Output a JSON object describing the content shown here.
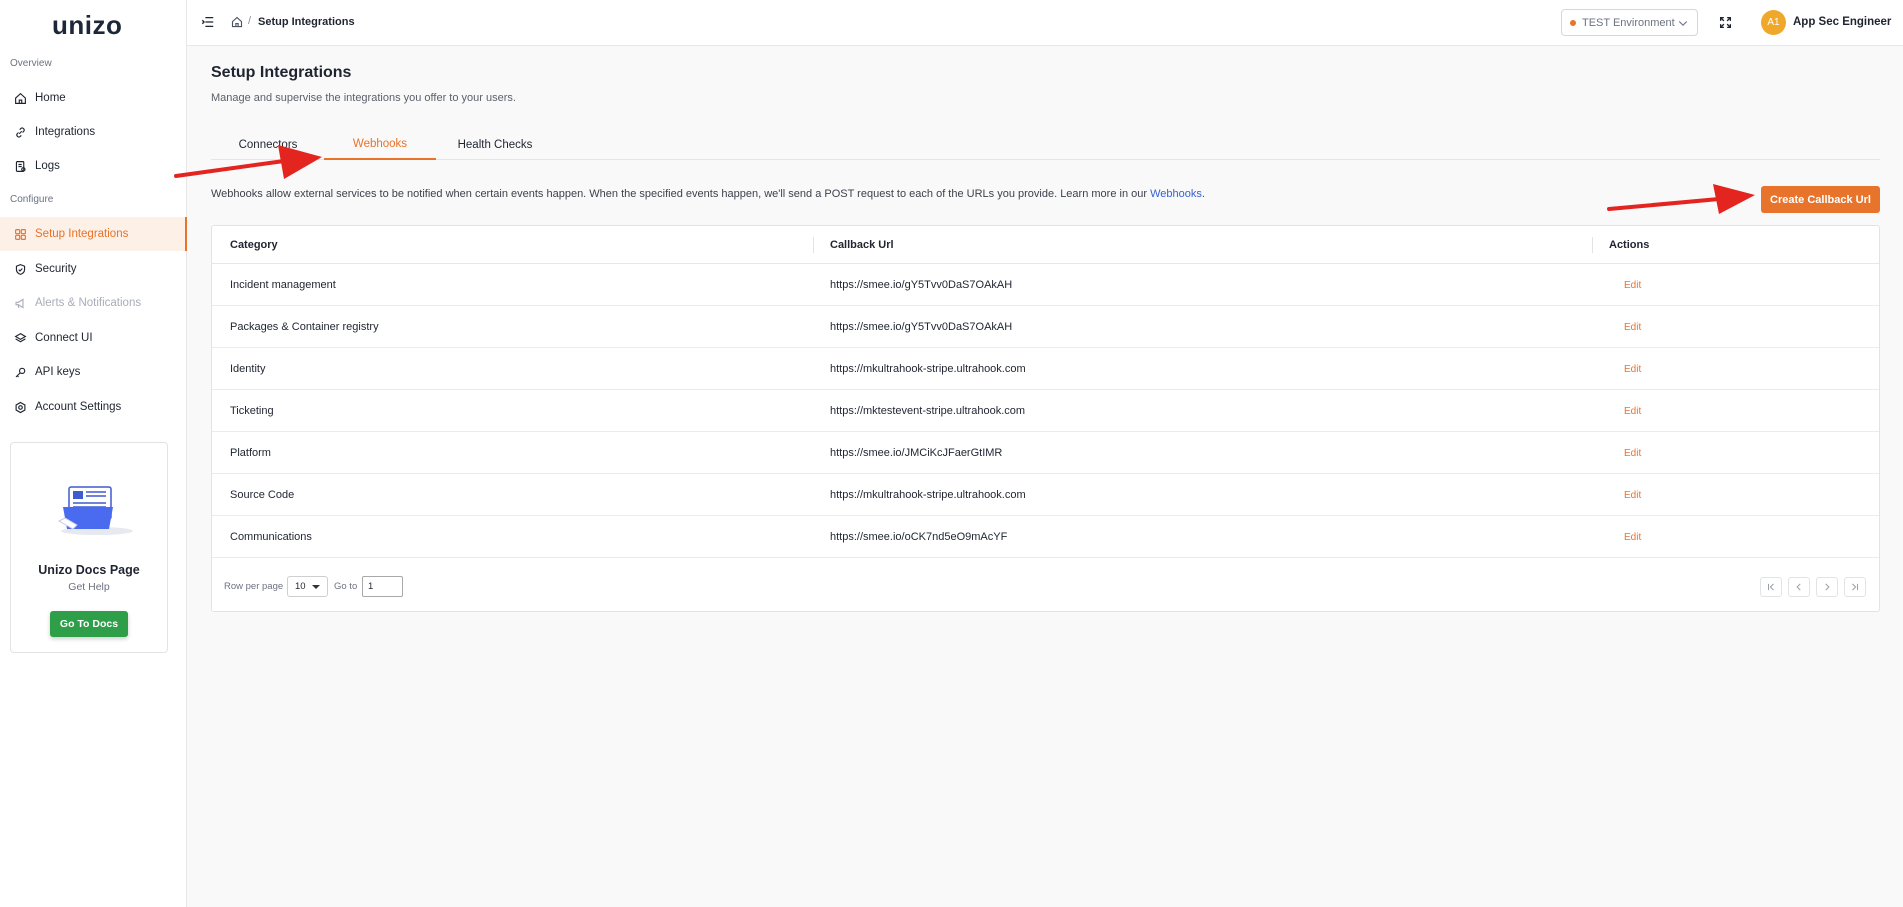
{
  "brand": {
    "logo": "unizo",
    "accent": "#e8732a"
  },
  "sidebar": {
    "sections": [
      {
        "label": "Overview"
      },
      {
        "label": "Configure"
      }
    ],
    "items": [
      {
        "label": "Home",
        "icon": "home-icon"
      },
      {
        "label": "Integrations",
        "icon": "link-icon"
      },
      {
        "label": "Logs",
        "icon": "logs-icon"
      },
      {
        "label": "Setup Integrations",
        "icon": "grid-icon",
        "active": true
      },
      {
        "label": "Security",
        "icon": "shield-icon"
      },
      {
        "label": "Alerts & Notifications",
        "icon": "megaphone-icon",
        "disabled": true
      },
      {
        "label": "Connect UI",
        "icon": "layers-icon"
      },
      {
        "label": "API keys",
        "icon": "key-icon"
      },
      {
        "label": "Account Settings",
        "icon": "gear-icon"
      }
    ],
    "docs_card": {
      "title": "Unizo Docs Page",
      "subtitle": "Get Help",
      "button": "Go To Docs"
    }
  },
  "topbar": {
    "breadcrumb_separator": "/",
    "breadcrumb_current": "Setup Integrations",
    "environment": "TEST Environment",
    "user_initials": "A1",
    "user_name": "App Sec Engineer"
  },
  "main": {
    "title": "Setup Integrations",
    "subtitle": "Manage and supervise the integrations you offer to your users.",
    "tabs": [
      {
        "label": "Connectors"
      },
      {
        "label": "Webhooks",
        "active": true
      },
      {
        "label": "Health Checks"
      }
    ],
    "description": "Webhooks allow external services to be notified when certain events happen. When the specified events happen, we'll send a POST request to each of the URLs you provide. Learn more in our ",
    "description_link": "Webhooks",
    "description_end": ".",
    "create_button": "Create Callback Url"
  },
  "table": {
    "columns": [
      "Category",
      "Callback Url",
      "Actions"
    ],
    "rows": [
      {
        "category": "Incident management",
        "url": "https://smee.io/gY5Tvv0DaS7OAkAH",
        "action": "Edit"
      },
      {
        "category": "Packages & Container registry",
        "url": "https://smee.io/gY5Tvv0DaS7OAkAH",
        "action": "Edit"
      },
      {
        "category": "Identity",
        "url": "https://mkultrahook-stripe.ultrahook.com",
        "action": "Edit"
      },
      {
        "category": "Ticketing",
        "url": "https://mktestevent-stripe.ultrahook.com",
        "action": "Edit"
      },
      {
        "category": "Platform",
        "url": "https://smee.io/JMCiKcJFaerGtIMR",
        "action": "Edit"
      },
      {
        "category": "Source Code",
        "url": "https://mkultrahook-stripe.ultrahook.com",
        "action": "Edit"
      },
      {
        "category": "Communications",
        "url": "https://smee.io/oCK7nd5eO9mAcYF",
        "action": "Edit"
      }
    ],
    "pager": {
      "rows_label": "Row per page",
      "rows_value": "10",
      "goto_label": "Go to",
      "goto_value": "1"
    }
  }
}
